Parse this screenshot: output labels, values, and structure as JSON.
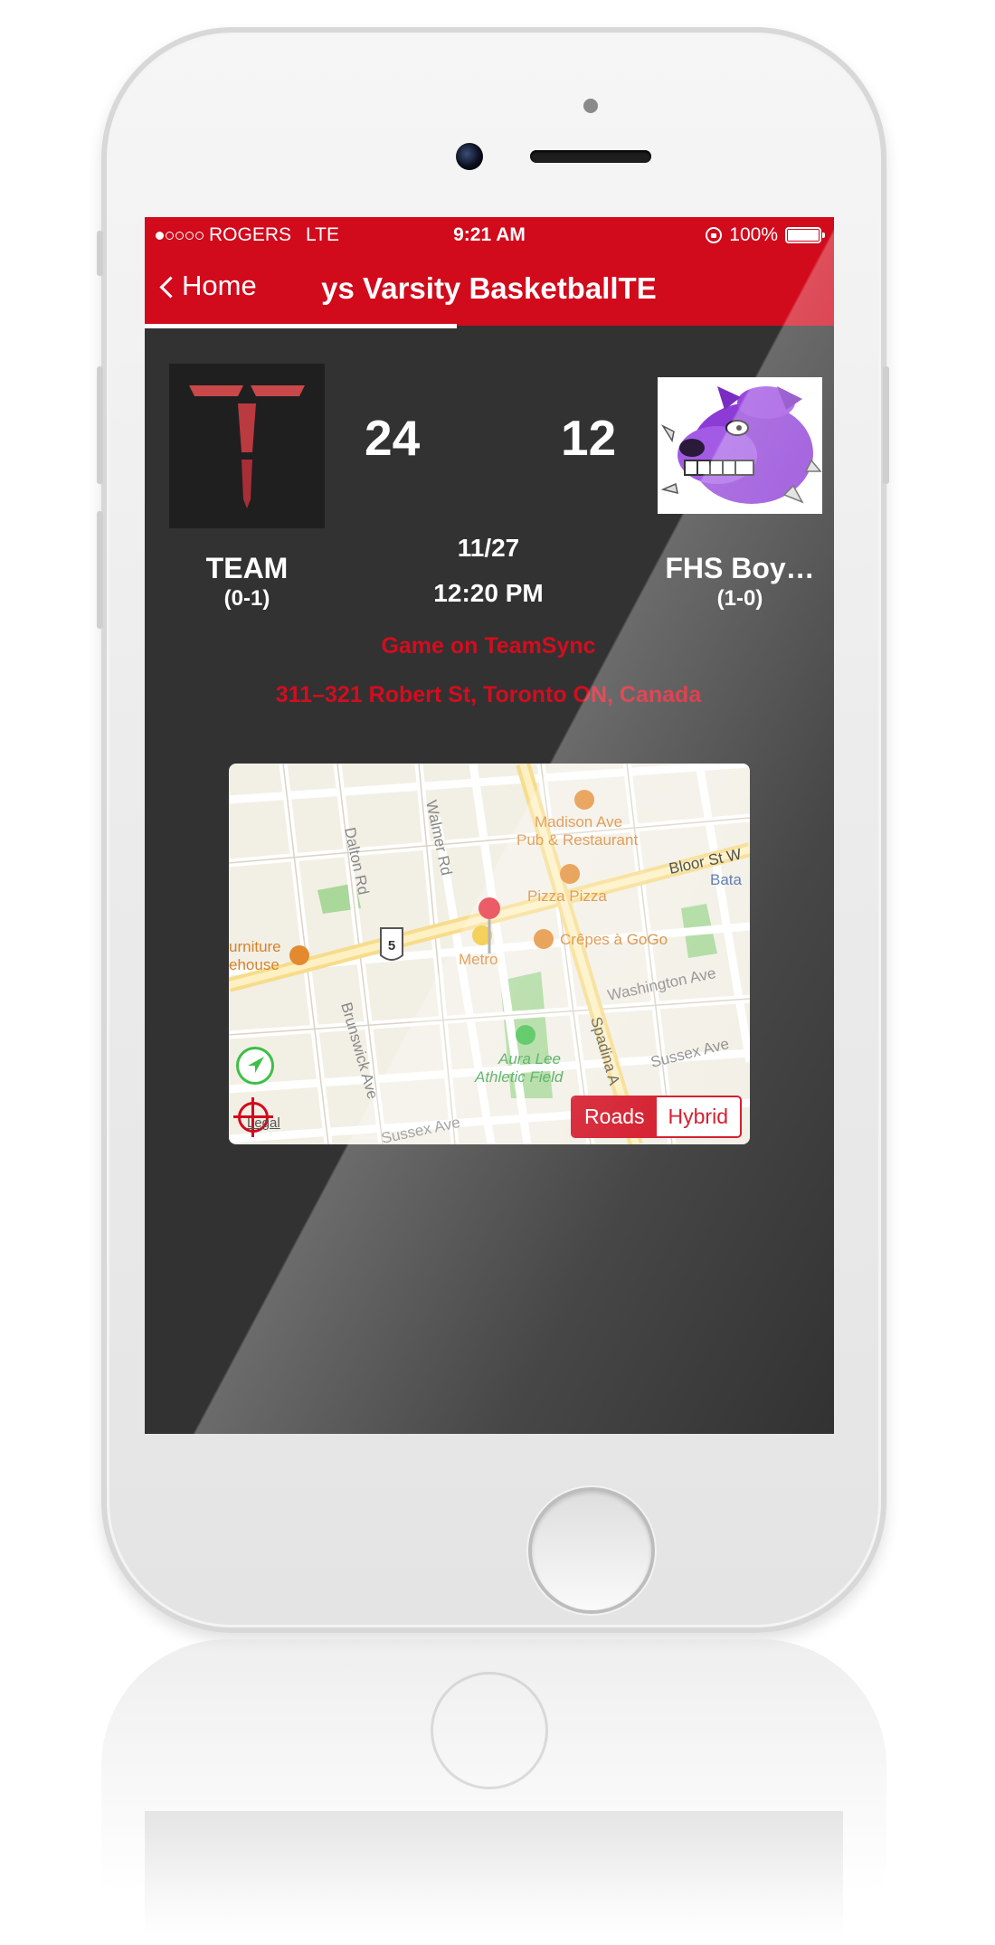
{
  "status_bar": {
    "carrier": "ROGERS",
    "network": "LTE",
    "time": "9:21 AM",
    "battery": "100%",
    "signal_bars_filled": 1,
    "signal_bars_total": 5
  },
  "nav": {
    "back_label": "Home",
    "title": "oys Varsity BasketballTE"
  },
  "game": {
    "home_team": {
      "name": "TEAM",
      "record": "(0-1)",
      "score": "24"
    },
    "away_team": {
      "name": "FHS Boy…",
      "record": "(1-0)",
      "score": "12"
    },
    "date": "11/27",
    "time": "12:20 PM",
    "link_label": "Game on TeamSync",
    "address": "311–321 Robert St, Toronto ON, Canada"
  },
  "map": {
    "labels": {
      "madison": "Madison Ave",
      "pub": "Pub & Restaurant",
      "bloor": "Bloor St W",
      "bata": "Bata",
      "pizza": "Pizza Pizza",
      "crepes": "Crêpes à GoGo",
      "washington": "Washington Ave",
      "furniture": "urniture",
      "warehouse": "ehouse",
      "metro": "Metro",
      "route": "5",
      "aura": "Aura Lee",
      "athletic": "Athletic Field",
      "sussex_right": "Sussex Ave",
      "sussex_bottom": "Sussex Ave",
      "dalton": "Dalton Rd",
      "walmer": "Walmer Rd",
      "brunswick": "Brunswick Ave",
      "spadina": "Spadina A",
      "legal": "Legal"
    },
    "mode_roads": "Roads",
    "mode_hybrid": "Hybrid",
    "selected_mode": "Roads"
  },
  "colors": {
    "brand_red": "#d10a1c",
    "screen_bg": "#323232",
    "map_bg": "#f2efe5",
    "poi_orange": "#e38a2e",
    "park_green": "#a9d89a"
  }
}
